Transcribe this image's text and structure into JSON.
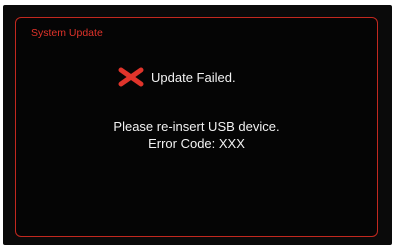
{
  "dialog": {
    "title": "System Update",
    "status_icon": "x-mark-icon",
    "status_text": "Update Failed.",
    "message_line1": "Please re-insert USB device.",
    "message_line2": "Error Code: XXX"
  },
  "colors": {
    "screen_background": "#0a0a0a",
    "border": "#c2281f",
    "title": "#e0332a",
    "x_icon": "#e0342b",
    "text": "#f2f2f2"
  }
}
